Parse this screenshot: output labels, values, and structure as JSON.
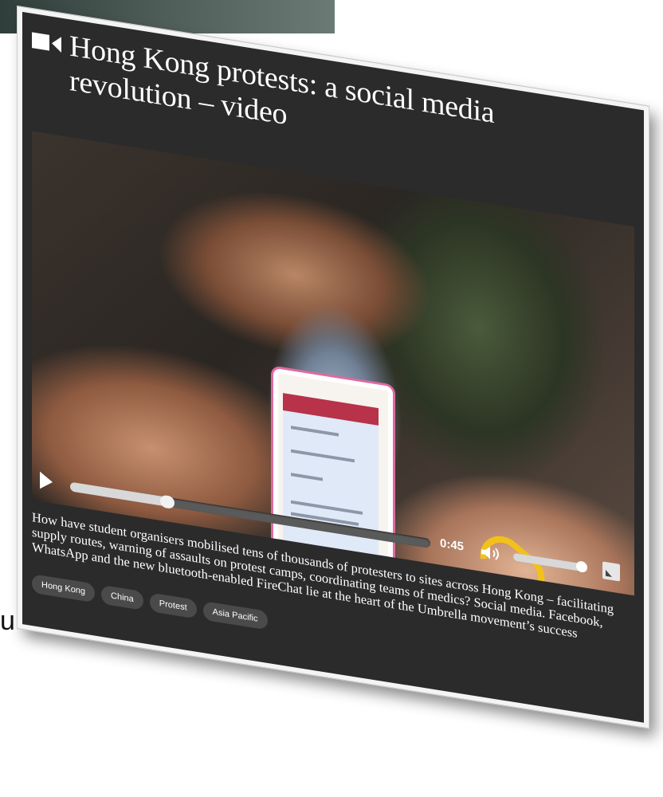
{
  "background": {
    "fragment_text": "u"
  },
  "article": {
    "title": "Hong Kong protests: a social media revolution – video",
    "media_icon": "video-camera-icon",
    "caption": "How have student organisers mobilised tens of thousands of protesters to sites across Hong Kong – facilitating supply routes, warning of assaults on protest camps, coordinating teams of medics? Social media. Facebook, WhatsApp and the new bluetooth-enabled FireChat lie at the heart of the Umbrella movement’s success",
    "tags": [
      "Hong Kong",
      "China",
      "Protest",
      "Asia Pacific"
    ]
  },
  "player": {
    "time": "0:45",
    "progress_fraction": 0.27,
    "volume_fraction": 0.95,
    "icons": {
      "play": "play-icon",
      "volume": "volume-icon",
      "fullscreen": "fullscreen-icon"
    }
  },
  "colors": {
    "card_background": "#2b2b2b",
    "text": "#ffffff",
    "tag_background": "#4a4a4a",
    "card_border": "#f4f4f4"
  }
}
